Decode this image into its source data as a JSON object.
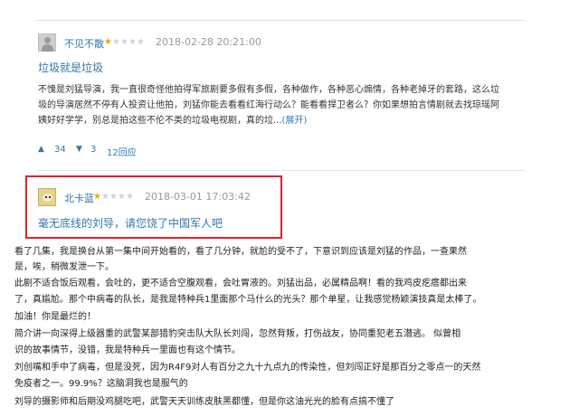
{
  "review1": {
    "username": "不见不散",
    "rating": 1,
    "time": "2018-02-28 20:21:00",
    "title": "垃圾就是垃圾",
    "lines": [
      "不愧是刘猛导演，我一直很奇怪他拍得军旅剧要多假有多假，各种做作，各种恶心煽情，各种老掉牙的套路，这么垃",
      "圾的导演居然不停有人投资让他拍，刘猛你能去看看红海行动么？能看看捍卫者么？你如果想拍言情剧就去找琼瑶阿",
      "姨好好学学，别总是拍这些不伦不类的垃圾电视剧，真的垃..."
    ],
    "expand": "(展开)",
    "upvotes": "34",
    "downvotes": "3",
    "replies": "12回应"
  },
  "review2": {
    "username": "北卡蓝",
    "rating": 1,
    "time": "2018-03-01 17:03:42",
    "title": "毫无底线的刘导，请您饶了中国军人吧"
  },
  "article": {
    "lines": [
      "看了几集，我是换台从第一集中间开始看的，看了几分钟，就尬的受不了，下意识到应该是刘猛的作品，一查果然",
      "是，唉，稍微发泄一下。",
      "此剧不适合饭后观看，会吐的，更不适合空腹观看，会吐胃液的。刘猛出品，必属精品啊！看的我鸡皮疙瘩都出来",
      "了，真尴尬。那个中病毒的队长，是我是特种兵1里面那个马什么的光头？那个单星，让我感觉杨颖演技真是太棒了。",
      "加油！你是最烂的！",
      "简介讲一向深得上级器重的武警某部猎豹突击队大队长刘闯，忽然背叛，打伤战友，协同重犯老五潜逃。        似曾相",
      "识的故事情节，没错，我是特种兵一里面也有这个情节。",
      "刘创嘴和手中了病毒，但是没死，因为R4F9对人有百分之九十九点九的传染性，但刘闯正好是那百分之零点一的天然",
      "免疫者之一。99.9%？这脑洞我也是服气的",
      "刘导的摄影师和后期没鸡腿吃吧，武警天天训练皮肤黑都懂，但是你这油光光的脸有点搞不懂了"
    ]
  },
  "colors": {
    "link": "#3377aa",
    "star": "#f3a500",
    "highlight_border": "#d9252f"
  },
  "icons": {
    "upvote": "triangle-up-icon",
    "downvote": "triangle-down-icon"
  }
}
